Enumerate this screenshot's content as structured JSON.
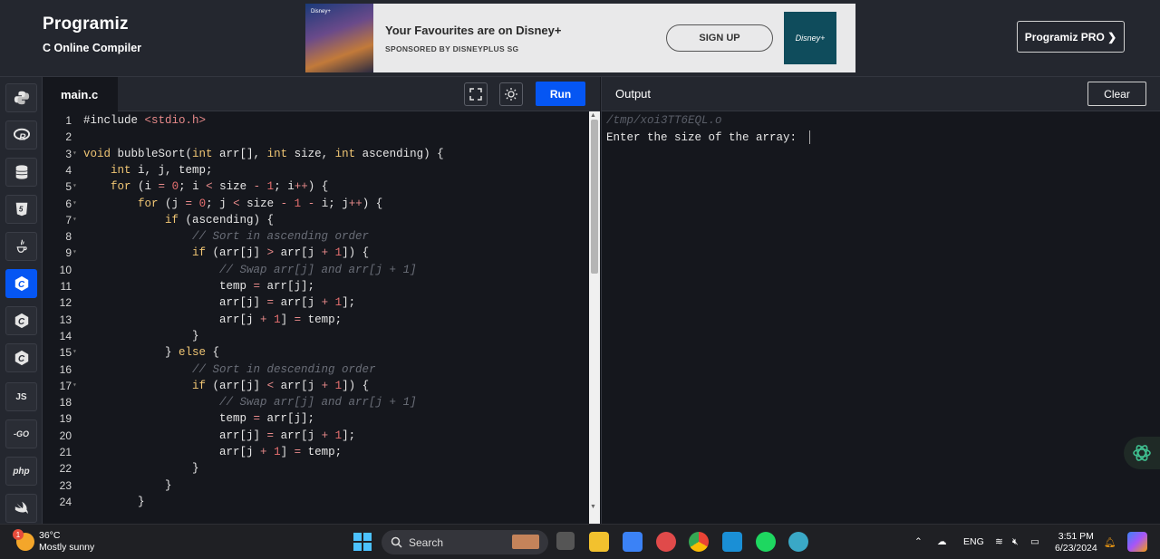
{
  "header": {
    "brand": "Programiz",
    "subtitle": "C Online Compiler",
    "pro_button": "Programiz PRO ❯"
  },
  "ad": {
    "title": "Your Favourites are on Disney+",
    "sponsor": "SPONSORED BY DISNEYPLUS SG",
    "cta": "SIGN UP",
    "logo_text": "Disney+"
  },
  "sidebar": {
    "items": [
      {
        "name": "python",
        "label": "🐍"
      },
      {
        "name": "r",
        "label": "R"
      },
      {
        "name": "sql",
        "label": "DB"
      },
      {
        "name": "html",
        "label": "5"
      },
      {
        "name": "java",
        "label": "☕"
      },
      {
        "name": "c",
        "label": "C"
      },
      {
        "name": "cpp",
        "label": "C"
      },
      {
        "name": "csharp",
        "label": "C"
      },
      {
        "name": "js",
        "label": "JS"
      },
      {
        "name": "go",
        "label": "-GO"
      },
      {
        "name": "php",
        "label": "php"
      },
      {
        "name": "swift",
        "label": "➹"
      }
    ]
  },
  "editor": {
    "file_tab": "main.c",
    "run_label": "Run",
    "lines": [
      {
        "n": "1",
        "html": "#include <span class='str'>&lt;stdio.h&gt;</span>"
      },
      {
        "n": "2",
        "html": ""
      },
      {
        "n": "3",
        "html": "<span class='kw'>void</span> bubbleSort(<span class='kw'>int</span> arr[], <span class='kw'>int</span> size, <span class='kw'>int</span> ascending) {"
      },
      {
        "n": "4",
        "html": "    <span class='kw'>int</span> i, j, temp;"
      },
      {
        "n": "5",
        "html": "    <span class='kw'>for</span> (i <span class='op'>=</span> <span class='num'>0</span>; i <span class='op'>&lt;</span> size <span class='op'>-</span> <span class='num'>1</span>; i<span class='op'>++</span>) {"
      },
      {
        "n": "6",
        "html": "        <span class='kw'>for</span> (j <span class='op'>=</span> <span class='num'>0</span>; j <span class='op'>&lt;</span> size <span class='op'>-</span> <span class='num'>1</span> <span class='op'>-</span> i; j<span class='op'>++</span>) {"
      },
      {
        "n": "7",
        "html": "            <span class='kw'>if</span> (ascending) {"
      },
      {
        "n": "8",
        "html": "                <span class='cm'>// Sort in ascending order</span>"
      },
      {
        "n": "9",
        "html": "                <span class='kw'>if</span> (arr[j] <span class='op'>&gt;</span> arr[j <span class='op'>+</span> <span class='num'>1</span>]) {"
      },
      {
        "n": "10",
        "html": "                    <span class='cm'>// Swap arr[j] and arr[j + 1]</span>"
      },
      {
        "n": "11",
        "html": "                    temp <span class='op'>=</span> arr[j];"
      },
      {
        "n": "12",
        "html": "                    arr[j] <span class='op'>=</span> arr[j <span class='op'>+</span> <span class='num'>1</span>];"
      },
      {
        "n": "13",
        "html": "                    arr[j <span class='op'>+</span> <span class='num'>1</span>] <span class='op'>=</span> temp;"
      },
      {
        "n": "14",
        "html": "                }"
      },
      {
        "n": "15",
        "html": "            } <span class='kw'>else</span> {"
      },
      {
        "n": "16",
        "html": "                <span class='cm'>// Sort in descending order</span>"
      },
      {
        "n": "17",
        "html": "                <span class='kw'>if</span> (arr[j] <span class='op'>&lt;</span> arr[j <span class='op'>+</span> <span class='num'>1</span>]) {"
      },
      {
        "n": "18",
        "html": "                    <span class='cm'>// Swap arr[j] and arr[j + 1]</span>"
      },
      {
        "n": "19",
        "html": "                    temp <span class='op'>=</span> arr[j];"
      },
      {
        "n": "20",
        "html": "                    arr[j] <span class='op'>=</span> arr[j <span class='op'>+</span> <span class='num'>1</span>];"
      },
      {
        "n": "21",
        "html": "                    arr[j <span class='op'>+</span> <span class='num'>1</span>] <span class='op'>=</span> temp;"
      },
      {
        "n": "22",
        "html": "                }"
      },
      {
        "n": "23",
        "html": "            }"
      },
      {
        "n": "24",
        "html": "        }"
      }
    ],
    "foldable": [
      "3",
      "5",
      "6",
      "7",
      "9",
      "15",
      "17"
    ]
  },
  "output": {
    "title": "Output",
    "clear_label": "Clear",
    "path": "/tmp/xoi3TT6EQL.o",
    "prompt": "Enter the size of the array: "
  },
  "taskbar": {
    "weather_temp": "36°C",
    "weather_desc": "Mostly sunny",
    "weather_badge": "1",
    "search_label": "Search",
    "lang": "ENG",
    "time": "3:51 PM",
    "date": "6/23/2024"
  },
  "colors": {
    "accent": "#0556f3",
    "keyword": "#f0c674",
    "operator": "#e88a8a",
    "comment": "#6a6e78"
  }
}
